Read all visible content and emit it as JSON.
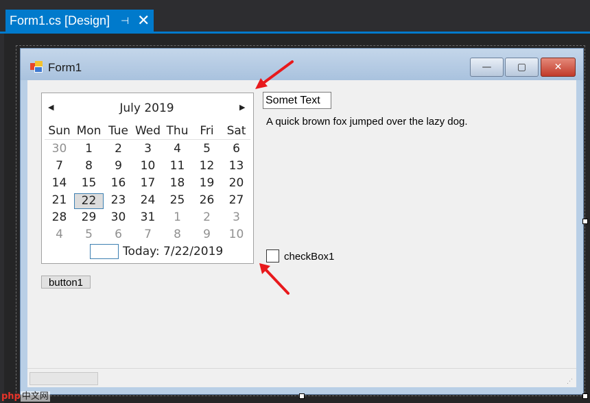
{
  "tab": {
    "title": "Form1.cs [Design]",
    "pin_glyph": "⊣",
    "close_glyph": "✕"
  },
  "form": {
    "title": "Form1",
    "buttons": {
      "min": "—",
      "max": "▢",
      "close": "✕"
    }
  },
  "calendar": {
    "month_label": "July 2019",
    "prev_glyph": "◀",
    "next_glyph": "▶",
    "day_headers": [
      "Sun",
      "Mon",
      "Tue",
      "Wed",
      "Thu",
      "Fri",
      "Sat"
    ],
    "weeks": [
      [
        "30",
        "1",
        "2",
        "3",
        "4",
        "5",
        "6"
      ],
      [
        "7",
        "8",
        "9",
        "10",
        "11",
        "12",
        "13"
      ],
      [
        "14",
        "15",
        "16",
        "17",
        "18",
        "19",
        "20"
      ],
      [
        "21",
        "22",
        "23",
        "24",
        "25",
        "26",
        "27"
      ],
      [
        "28",
        "29",
        "30",
        "31",
        "1",
        "2",
        "3"
      ],
      [
        "4",
        "5",
        "6",
        "7",
        "8",
        "9",
        "10"
      ]
    ],
    "selected_day": "22",
    "today_label": "Today: 7/22/2019"
  },
  "textbox": {
    "value": "Somet Text"
  },
  "label1": {
    "text": "A quick brown fox jumped over the lazy dog."
  },
  "checkbox": {
    "label": "checkBox1",
    "checked": false
  },
  "button1": {
    "label": "button1"
  },
  "watermark": {
    "latin": "php",
    "cn": "中文网"
  },
  "colors": {
    "accent": "#007acc",
    "arrow": "#e8191c"
  }
}
